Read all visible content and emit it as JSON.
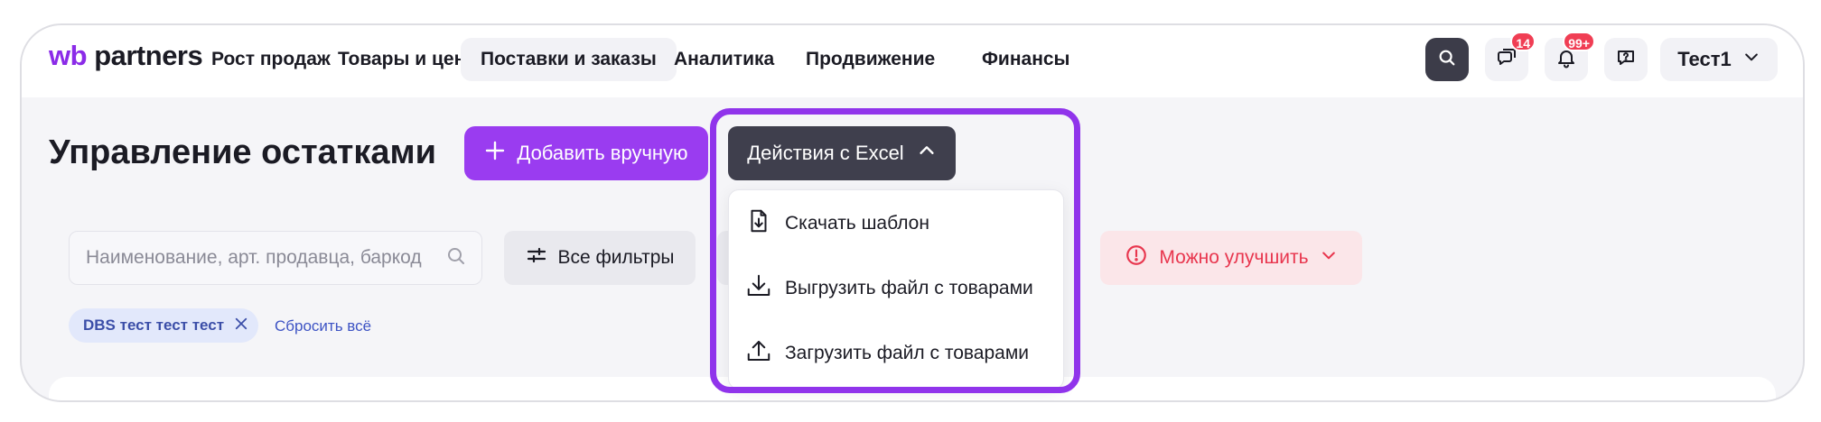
{
  "brand": {
    "logo_wb": "wb",
    "logo_partners": "partners"
  },
  "nav": {
    "items": [
      {
        "label": "Рост продаж"
      },
      {
        "label": "Товары и цены"
      },
      {
        "label": "Поставки и заказы",
        "active": true
      },
      {
        "label": "Аналитика"
      },
      {
        "label": "Продвижение"
      },
      {
        "label": "Финансы"
      }
    ]
  },
  "header_icons": {
    "search": "search-icon",
    "chat": "chat-icon",
    "chat_badge": "14",
    "notifications": "bell-icon",
    "notifications_badge": "99+",
    "support": "help-chat-icon"
  },
  "user": {
    "name": "Тест1"
  },
  "page": {
    "title": "Управление остатками"
  },
  "actions": {
    "add_manual_label": "Добавить вручную",
    "excel_label": "Действия с Excel"
  },
  "excel_menu": {
    "items": [
      {
        "label": "Скачать шаблон",
        "icon": "file-download-icon"
      },
      {
        "label": "Выгрузить файл с товарами",
        "icon": "download-icon"
      },
      {
        "label": "Загрузить файл с товарами",
        "icon": "upload-icon"
      }
    ]
  },
  "filters": {
    "search_placeholder": "Наименование, арт. продавца, баркод",
    "all_filters_label": "Все фильтры",
    "improve_label": "Можно улучшить",
    "active_chip": "DBS тест тест тест",
    "reset_label": "Сбросить всё"
  },
  "colors": {
    "brand_purple": "#9a3cf0",
    "highlight": "#9034eb",
    "dark_button": "#3f3f4d",
    "warning_red": "#e8364e",
    "badge_red": "#f03e54"
  }
}
